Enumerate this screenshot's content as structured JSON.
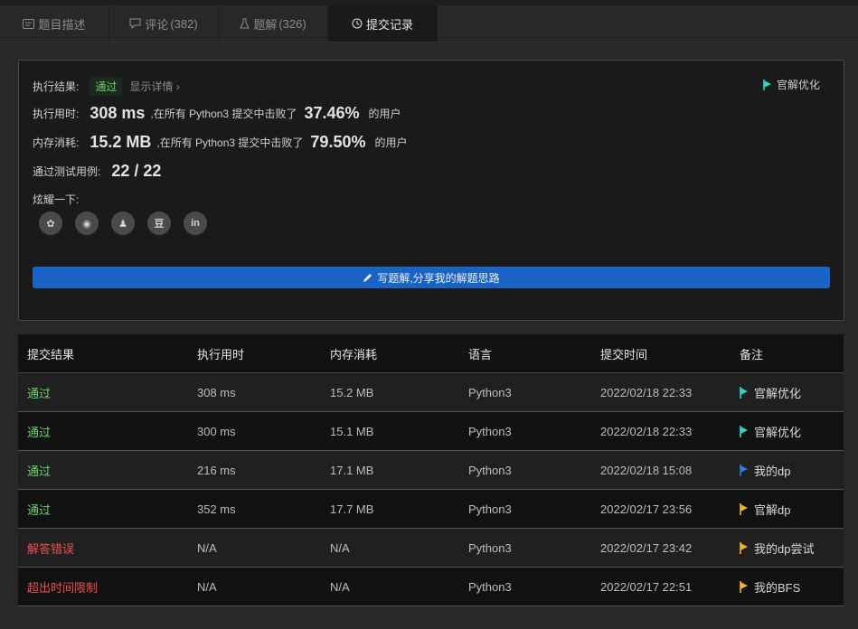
{
  "tabs": [
    {
      "label": "题目描述",
      "count": ""
    },
    {
      "label": "评论",
      "count": "(382)"
    },
    {
      "label": "题解",
      "count": "(326)"
    },
    {
      "label": "提交记录",
      "count": ""
    }
  ],
  "result": {
    "status_label": "执行结果:",
    "status_value": "通过",
    "detail_link": "显示详情 ›",
    "official_link": "官解优化",
    "runtime_label": "执行用时:",
    "runtime_value": "308 ms",
    "runtime_text": ",在所有 Python3 提交中击败了",
    "runtime_pct": "37.46%",
    "runtime_suffix": "的用户",
    "memory_label": "内存消耗:",
    "memory_value": "15.2 MB",
    "memory_text": ",在所有 Python3 提交中击败了",
    "memory_pct": "79.50%",
    "memory_suffix": "的用户",
    "tests_label": "通过测试用例:",
    "tests_value": "22 / 22",
    "share_label": "炫耀一下:",
    "share_icons": [
      "wechat-icon",
      "weibo-icon",
      "qq-icon",
      "douban-icon",
      "linkedin-icon"
    ],
    "share_glyphs": [
      "✿",
      "◉",
      "♟",
      "豆",
      "in"
    ],
    "write_button": "写题解,分享我的解题思路"
  },
  "table": {
    "headers": [
      "提交结果",
      "执行用时",
      "内存消耗",
      "语言",
      "提交时间",
      "备注"
    ],
    "rows": [
      {
        "result": "通过",
        "status": "ok",
        "runtime": "308 ms",
        "memory": "15.2 MB",
        "lang": "Python3",
        "time": "2022/02/18 22:33",
        "note": "官解优化",
        "flag": "#2fd5c8"
      },
      {
        "result": "通过",
        "status": "ok",
        "runtime": "300 ms",
        "memory": "15.1 MB",
        "lang": "Python3",
        "time": "2022/02/18 22:33",
        "note": "官解优化",
        "flag": "#2fd5c8"
      },
      {
        "result": "通过",
        "status": "ok",
        "runtime": "216 ms",
        "memory": "17.1 MB",
        "lang": "Python3",
        "time": "2022/02/18 15:08",
        "note": "我的dp",
        "flag": "#2f7de0"
      },
      {
        "result": "通过",
        "status": "ok",
        "runtime": "352 ms",
        "memory": "17.7 MB",
        "lang": "Python3",
        "time": "2022/02/17 23:56",
        "note": "官解dp",
        "flag": "#f0b429"
      },
      {
        "result": "解答错误",
        "status": "err",
        "runtime": "N/A",
        "memory": "N/A",
        "lang": "Python3",
        "time": "2022/02/17 23:42",
        "note": "我的dp尝试",
        "flag": "#f0b429"
      },
      {
        "result": "超出时间限制",
        "status": "err",
        "runtime": "N/A",
        "memory": "N/A",
        "lang": "Python3",
        "time": "2022/02/17 22:51",
        "note": "我的BFS",
        "flag": "#f0b429"
      }
    ]
  },
  "colors": {
    "pass": "#6bd36b",
    "error": "#f14d4d",
    "accent": "#1a63c6"
  }
}
